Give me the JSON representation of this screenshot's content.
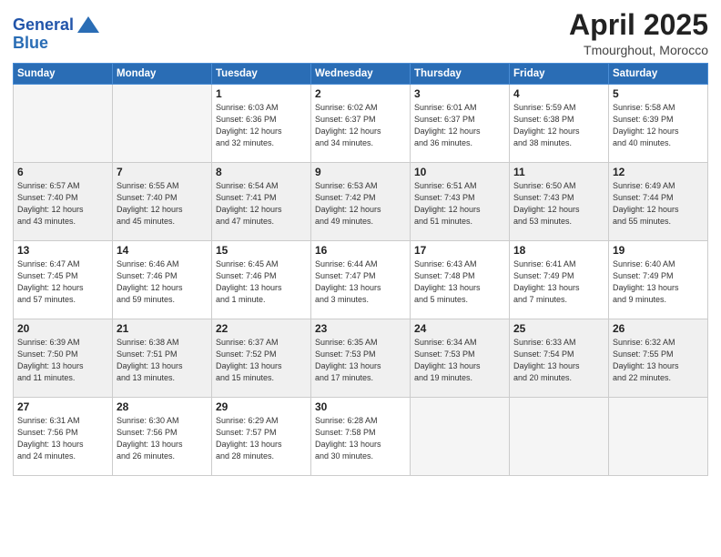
{
  "logo": {
    "line1": "General",
    "line2": "Blue"
  },
  "title": {
    "month_year": "April 2025",
    "location": "Tmourghout, Morocco"
  },
  "weekdays": [
    "Sunday",
    "Monday",
    "Tuesday",
    "Wednesday",
    "Thursday",
    "Friday",
    "Saturday"
  ],
  "weeks": [
    [
      {
        "day": "",
        "info": ""
      },
      {
        "day": "",
        "info": ""
      },
      {
        "day": "1",
        "info": "Sunrise: 6:03 AM\nSunset: 6:36 PM\nDaylight: 12 hours\nand 32 minutes."
      },
      {
        "day": "2",
        "info": "Sunrise: 6:02 AM\nSunset: 6:37 PM\nDaylight: 12 hours\nand 34 minutes."
      },
      {
        "day": "3",
        "info": "Sunrise: 6:01 AM\nSunset: 6:37 PM\nDaylight: 12 hours\nand 36 minutes."
      },
      {
        "day": "4",
        "info": "Sunrise: 5:59 AM\nSunset: 6:38 PM\nDaylight: 12 hours\nand 38 minutes."
      },
      {
        "day": "5",
        "info": "Sunrise: 5:58 AM\nSunset: 6:39 PM\nDaylight: 12 hours\nand 40 minutes."
      }
    ],
    [
      {
        "day": "6",
        "info": "Sunrise: 6:57 AM\nSunset: 7:40 PM\nDaylight: 12 hours\nand 43 minutes."
      },
      {
        "day": "7",
        "info": "Sunrise: 6:55 AM\nSunset: 7:40 PM\nDaylight: 12 hours\nand 45 minutes."
      },
      {
        "day": "8",
        "info": "Sunrise: 6:54 AM\nSunset: 7:41 PM\nDaylight: 12 hours\nand 47 minutes."
      },
      {
        "day": "9",
        "info": "Sunrise: 6:53 AM\nSunset: 7:42 PM\nDaylight: 12 hours\nand 49 minutes."
      },
      {
        "day": "10",
        "info": "Sunrise: 6:51 AM\nSunset: 7:43 PM\nDaylight: 12 hours\nand 51 minutes."
      },
      {
        "day": "11",
        "info": "Sunrise: 6:50 AM\nSunset: 7:43 PM\nDaylight: 12 hours\nand 53 minutes."
      },
      {
        "day": "12",
        "info": "Sunrise: 6:49 AM\nSunset: 7:44 PM\nDaylight: 12 hours\nand 55 minutes."
      }
    ],
    [
      {
        "day": "13",
        "info": "Sunrise: 6:47 AM\nSunset: 7:45 PM\nDaylight: 12 hours\nand 57 minutes."
      },
      {
        "day": "14",
        "info": "Sunrise: 6:46 AM\nSunset: 7:46 PM\nDaylight: 12 hours\nand 59 minutes."
      },
      {
        "day": "15",
        "info": "Sunrise: 6:45 AM\nSunset: 7:46 PM\nDaylight: 13 hours\nand 1 minute."
      },
      {
        "day": "16",
        "info": "Sunrise: 6:44 AM\nSunset: 7:47 PM\nDaylight: 13 hours\nand 3 minutes."
      },
      {
        "day": "17",
        "info": "Sunrise: 6:43 AM\nSunset: 7:48 PM\nDaylight: 13 hours\nand 5 minutes."
      },
      {
        "day": "18",
        "info": "Sunrise: 6:41 AM\nSunset: 7:49 PM\nDaylight: 13 hours\nand 7 minutes."
      },
      {
        "day": "19",
        "info": "Sunrise: 6:40 AM\nSunset: 7:49 PM\nDaylight: 13 hours\nand 9 minutes."
      }
    ],
    [
      {
        "day": "20",
        "info": "Sunrise: 6:39 AM\nSunset: 7:50 PM\nDaylight: 13 hours\nand 11 minutes."
      },
      {
        "day": "21",
        "info": "Sunrise: 6:38 AM\nSunset: 7:51 PM\nDaylight: 13 hours\nand 13 minutes."
      },
      {
        "day": "22",
        "info": "Sunrise: 6:37 AM\nSunset: 7:52 PM\nDaylight: 13 hours\nand 15 minutes."
      },
      {
        "day": "23",
        "info": "Sunrise: 6:35 AM\nSunset: 7:53 PM\nDaylight: 13 hours\nand 17 minutes."
      },
      {
        "day": "24",
        "info": "Sunrise: 6:34 AM\nSunset: 7:53 PM\nDaylight: 13 hours\nand 19 minutes."
      },
      {
        "day": "25",
        "info": "Sunrise: 6:33 AM\nSunset: 7:54 PM\nDaylight: 13 hours\nand 20 minutes."
      },
      {
        "day": "26",
        "info": "Sunrise: 6:32 AM\nSunset: 7:55 PM\nDaylight: 13 hours\nand 22 minutes."
      }
    ],
    [
      {
        "day": "27",
        "info": "Sunrise: 6:31 AM\nSunset: 7:56 PM\nDaylight: 13 hours\nand 24 minutes."
      },
      {
        "day": "28",
        "info": "Sunrise: 6:30 AM\nSunset: 7:56 PM\nDaylight: 13 hours\nand 26 minutes."
      },
      {
        "day": "29",
        "info": "Sunrise: 6:29 AM\nSunset: 7:57 PM\nDaylight: 13 hours\nand 28 minutes."
      },
      {
        "day": "30",
        "info": "Sunrise: 6:28 AM\nSunset: 7:58 PM\nDaylight: 13 hours\nand 30 minutes."
      },
      {
        "day": "",
        "info": ""
      },
      {
        "day": "",
        "info": ""
      },
      {
        "day": "",
        "info": ""
      }
    ]
  ]
}
